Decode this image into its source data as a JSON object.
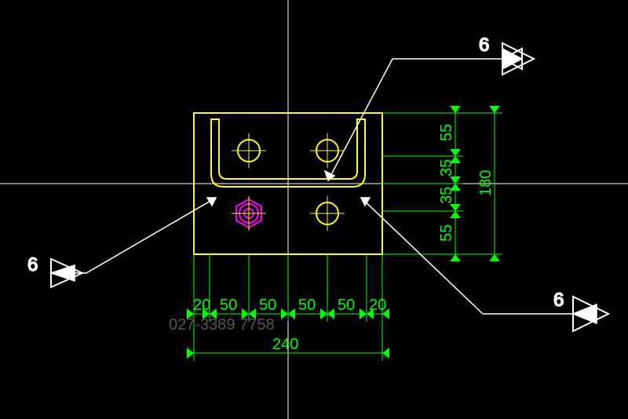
{
  "dimensions": {
    "bottom_seq": [
      "20",
      "50",
      "50",
      "50",
      "50",
      "20"
    ],
    "bottom_total": "240",
    "right_seq": [
      "55",
      "35",
      "35",
      "55"
    ],
    "right_total": "180"
  },
  "leaders": {
    "top": "6",
    "left": "6",
    "right": "6"
  },
  "watermark": "027-3389 7758"
}
